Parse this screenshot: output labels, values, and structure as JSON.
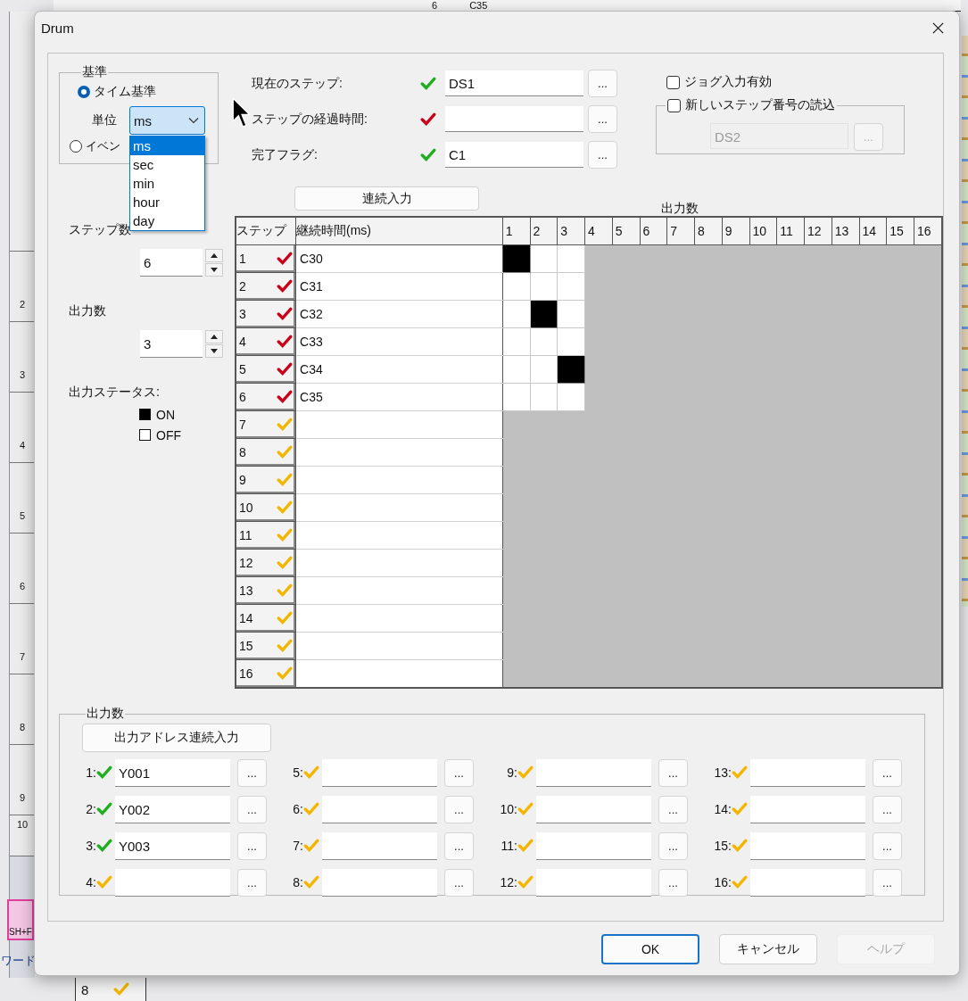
{
  "background": {
    "top_cells": [
      "6",
      "C35"
    ],
    "ruler": [
      "2",
      "3",
      "4",
      "5",
      "6",
      "7",
      "8",
      "9",
      "10"
    ],
    "tool_button": "SH+F",
    "status_text": "ワード",
    "bottom_cell": {
      "label": "8",
      "color": "#f2b600"
    }
  },
  "dialog": {
    "title": "Drum"
  },
  "base_group": {
    "title": "基準",
    "options": [
      {
        "label": "タイム基準",
        "selected": true
      },
      {
        "label": "イベン",
        "selected": false
      }
    ],
    "unit_label": "単位",
    "unit": {
      "value": "ms",
      "expanded": true,
      "options": [
        {
          "label": "ms",
          "selected": true
        },
        {
          "label": "sec",
          "selected": false
        },
        {
          "label": "min",
          "selected": false
        },
        {
          "label": "hour",
          "selected": false
        },
        {
          "label": "day",
          "selected": false
        }
      ]
    }
  },
  "address_fields": [
    {
      "label": "現在のステップ:",
      "color": "#1fae1f",
      "value": "DS1",
      "browse": "..."
    },
    {
      "label": "ステップの経過時間:",
      "color": "#c8001a",
      "browse": "..."
    },
    {
      "label": "完了フラグ:",
      "color": "#1fae1f",
      "value": "C1",
      "browse": "..."
    }
  ],
  "jog": {
    "label": "ジョグ入力有効",
    "checked": false
  },
  "load_step": {
    "label": "新しいステップ番号の読込",
    "checked": false,
    "value": "DS2",
    "browse": "...",
    "disabled": true
  },
  "steps": {
    "label": "ステップ数",
    "value": "6"
  },
  "outputs": {
    "label": "出力数",
    "value": "3"
  },
  "status_legend": {
    "title": "出力ステータス:",
    "items": [
      {
        "label": "ON",
        "on": true
      },
      {
        "label": "OFF",
        "on": false
      }
    ]
  },
  "sequential_button": "連続入力",
  "table": {
    "outputs_caption": "出力数",
    "columns": [
      "ステップ",
      "継続時間(ms)"
    ],
    "output_columns": [
      "1",
      "2",
      "3",
      "4",
      "5",
      "6",
      "7",
      "8",
      "9",
      "10",
      "11",
      "12",
      "13",
      "14",
      "15",
      "16"
    ],
    "rows": [
      {
        "step": "1",
        "color": "#c8001a",
        "duration": "C30",
        "outputs": [
          true,
          false,
          false
        ]
      },
      {
        "step": "2",
        "color": "#c8001a",
        "duration": "C31",
        "outputs": [
          false,
          false,
          false
        ]
      },
      {
        "step": "3",
        "color": "#c8001a",
        "duration": "C32",
        "outputs": [
          false,
          true,
          false
        ]
      },
      {
        "step": "4",
        "color": "#c8001a",
        "duration": "C33",
        "outputs": [
          false,
          false,
          false
        ]
      },
      {
        "step": "5",
        "color": "#c8001a",
        "duration": "C34",
        "outputs": [
          false,
          false,
          true
        ]
      },
      {
        "step": "6",
        "color": "#c8001a",
        "duration": "C35",
        "outputs": [
          false,
          false,
          false
        ]
      },
      {
        "step": "7",
        "color": "#f2b600"
      },
      {
        "step": "8",
        "color": "#f2b600"
      },
      {
        "step": "9",
        "color": "#f2b600"
      },
      {
        "step": "10",
        "color": "#f2b600"
      },
      {
        "step": "11",
        "color": "#f2b600"
      },
      {
        "step": "12",
        "color": "#f2b600"
      },
      {
        "step": "13",
        "color": "#f2b600"
      },
      {
        "step": "14",
        "color": "#f2b600"
      },
      {
        "step": "15",
        "color": "#f2b600"
      },
      {
        "step": "16",
        "color": "#f2b600"
      }
    ]
  },
  "output_group": {
    "title": "出力数",
    "button": "出力アドレス連続入力",
    "items": [
      {
        "label": "1:",
        "color": "#1fae1f",
        "value": "Y001",
        "browse": "..."
      },
      {
        "label": "2:",
        "color": "#1fae1f",
        "value": "Y002",
        "browse": "..."
      },
      {
        "label": "3:",
        "color": "#1fae1f",
        "value": "Y003",
        "browse": "..."
      },
      {
        "label": "4:",
        "color": "#f2b600",
        "browse": "..."
      },
      {
        "label": "5:",
        "color": "#f2b600",
        "browse": "..."
      },
      {
        "label": "6:",
        "color": "#f2b600",
        "browse": "..."
      },
      {
        "label": "7:",
        "color": "#f2b600",
        "browse": "..."
      },
      {
        "label": "8:",
        "color": "#f2b600",
        "browse": "..."
      },
      {
        "label": "9:",
        "color": "#f2b600",
        "browse": "..."
      },
      {
        "label": "10:",
        "color": "#f2b600",
        "browse": "..."
      },
      {
        "label": "11:",
        "color": "#f2b600",
        "browse": "..."
      },
      {
        "label": "12:",
        "color": "#f2b600",
        "browse": "..."
      },
      {
        "label": "13:",
        "color": "#f2b600",
        "browse": "..."
      },
      {
        "label": "14:",
        "color": "#f2b600",
        "browse": "..."
      },
      {
        "label": "15:",
        "color": "#f2b600",
        "browse": "..."
      },
      {
        "label": "16:",
        "color": "#f2b600",
        "browse": "..."
      }
    ]
  },
  "buttons": [
    {
      "label": "OK",
      "default": true,
      "disabled": false
    },
    {
      "label": "キャンセル",
      "default": false,
      "disabled": false
    },
    {
      "label": "ヘルプ",
      "default": false,
      "disabled": true
    }
  ]
}
